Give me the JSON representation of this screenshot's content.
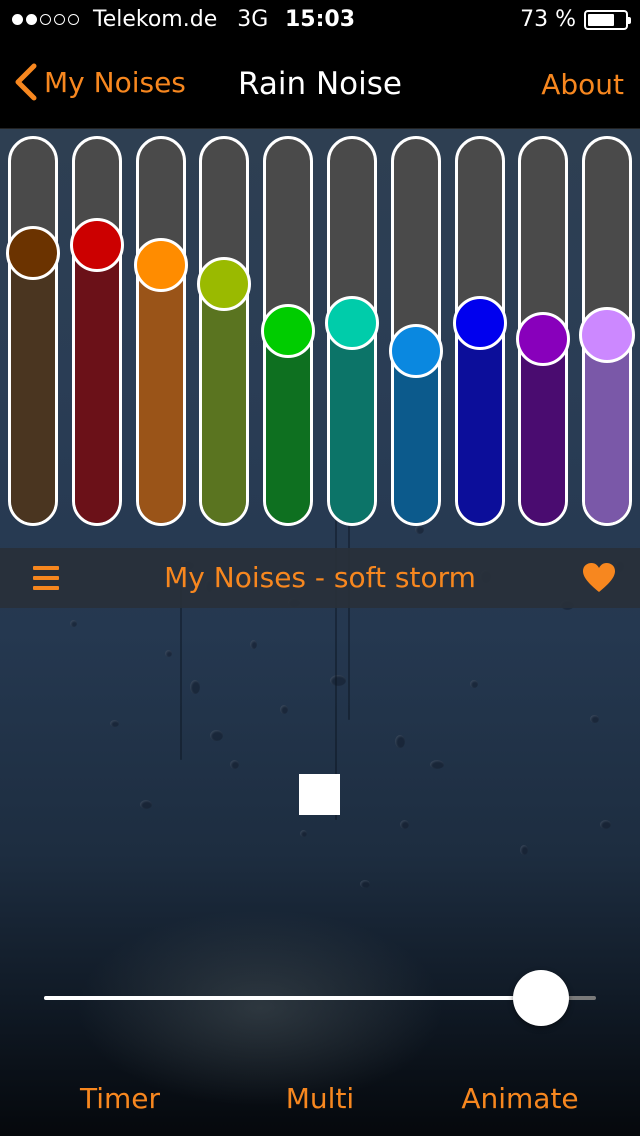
{
  "status_bar": {
    "signal_dots_filled": 2,
    "signal_dots_total": 5,
    "carrier": "Telekom.de",
    "network": "3G",
    "time": "15:03",
    "battery_text": "73 %",
    "battery_level": 0.73
  },
  "nav": {
    "back_label": "My Noises",
    "title": "Rain Noise",
    "about_label": "About"
  },
  "equalizer": {
    "bands": [
      {
        "level": 0.7,
        "knob_color": "#6b3300",
        "fill_color": "#4a3520"
      },
      {
        "level": 0.72,
        "knob_color": "#cc0000",
        "fill_color": "#6b1118"
      },
      {
        "level": 0.67,
        "knob_color": "#ff8c00",
        "fill_color": "#9a5418"
      },
      {
        "level": 0.62,
        "knob_color": "#9aba00",
        "fill_color": "#5a7420"
      },
      {
        "level": 0.5,
        "knob_color": "#00cc00",
        "fill_color": "#0e7020"
      },
      {
        "level": 0.52,
        "knob_color": "#00ccaa",
        "fill_color": "#0c7468"
      },
      {
        "level": 0.45,
        "knob_color": "#0a88e0",
        "fill_color": "#0c5a8c"
      },
      {
        "level": 0.52,
        "knob_color": "#0000ee",
        "fill_color": "#0c0e9a"
      },
      {
        "level": 0.48,
        "knob_color": "#8800bb",
        "fill_color": "#4a0c70"
      },
      {
        "level": 0.49,
        "knob_color": "#cc88ff",
        "fill_color": "#7a58a8"
      }
    ]
  },
  "preset": {
    "name": "My Noises - soft storm",
    "menu_icon": "hamburger-menu-icon",
    "favorite_icon": "heart-icon"
  },
  "player": {
    "stop_icon": "stop-icon",
    "volume_level": 0.9
  },
  "tabs": [
    {
      "label": "Timer"
    },
    {
      "label": "Multi"
    },
    {
      "label": "Animate"
    }
  ],
  "colors": {
    "accent": "#f7871f"
  }
}
